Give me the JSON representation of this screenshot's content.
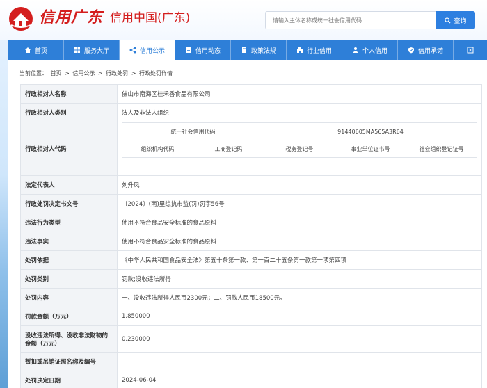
{
  "header": {
    "logo_script": "信用广东",
    "logo_text": "信用中国(广东)",
    "search_placeholder": "请输入主体名称或统一社会信用代码",
    "search_button": "查询"
  },
  "nav": [
    {
      "label": "首页",
      "icon": "home-icon"
    },
    {
      "label": "服务大厅",
      "icon": "grid-icon"
    },
    {
      "label": "信用公示",
      "icon": "share-icon",
      "active": true
    },
    {
      "label": "信用动态",
      "icon": "document-icon"
    },
    {
      "label": "政策法规",
      "icon": "book-icon"
    },
    {
      "label": "行业信用",
      "icon": "building-icon"
    },
    {
      "label": "个人信用",
      "icon": "person-icon"
    },
    {
      "label": "信用承诺",
      "icon": "shield-icon"
    },
    {
      "label": "",
      "icon": "expand-icon"
    }
  ],
  "breadcrumb": {
    "prefix": "当前位置：",
    "items": [
      "首页",
      "信用公示",
      "行政处罚",
      "行政处罚详情"
    ],
    "sep": ">"
  },
  "rows": {
    "name": {
      "label": "行政相对人名称",
      "value": "佛山市南海区桂禾香食品有限公司"
    },
    "type": {
      "label": "行政相对人类别",
      "value": "法人及非法人组织"
    },
    "code": {
      "label": "行政相对人代码",
      "uscc_label": "统一社会信用代码",
      "uscc_value": "91440605MA565A3R64",
      "sub_headers": [
        "组织机构代码",
        "工商登记码",
        "税务登记号",
        "事业单位证书号",
        "社会组织登记证号"
      ]
    },
    "legal_rep": {
      "label": "法定代表人",
      "value": "刘升凤"
    },
    "doc_no": {
      "label": "行政处罚决定书文号",
      "value": "〔2024〕(南)里综执市监(罚)罚字56号"
    },
    "violation_type": {
      "label": "违法行为类型",
      "value": "使用不符合食品安全标准的食品原料"
    },
    "violation_fact": {
      "label": "违法事实",
      "value": "使用不符合食品安全标准的食品原料"
    },
    "basis": {
      "label": "处罚依据",
      "value": "《中华人民共和国食品安全法》第五十条第一款、第一百二十五条第一款第一项第四项"
    },
    "category": {
      "label": "处罚类别",
      "value": "罚款;没收违法所得"
    },
    "content": {
      "label": "处罚内容",
      "value": "一、没收违法所得人民币2300元；二、罚款人民币18500元。"
    },
    "fine": {
      "label": "罚款金额（万元）",
      "value": "1.850000"
    },
    "confiscated": {
      "label": "没收违法所得、没收非法财物的金额（万元）",
      "value": "0.230000"
    },
    "license": {
      "label": "暂扣或吊销证照名称及编号",
      "value": ""
    },
    "date": {
      "label": "处罚决定日期",
      "value": "2024-06-04"
    }
  }
}
